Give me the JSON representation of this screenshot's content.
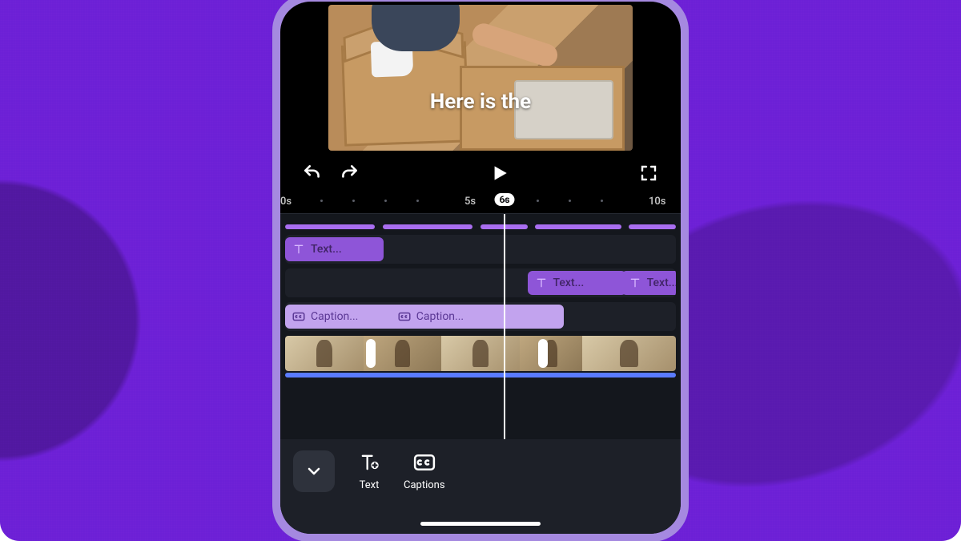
{
  "preview": {
    "caption_text": "Here is the"
  },
  "controls": {
    "undo_icon": "undo-icon",
    "redo_icon": "redo-icon",
    "play_icon": "play-icon",
    "fullscreen_icon": "fullscreen-icon"
  },
  "ruler": {
    "ticks": [
      "0s",
      "5s",
      "10s"
    ],
    "current_label": "6s",
    "playhead_pct": 56
  },
  "timeline": {
    "marker_segments_pct": [
      [
        0,
        23
      ],
      [
        25,
        48
      ],
      [
        50,
        62
      ],
      [
        64,
        86
      ],
      [
        88,
        100
      ]
    ],
    "text_clips_row1": [
      {
        "label": "Text...",
        "left_pct": 0,
        "width_pct": 22
      }
    ],
    "text_clips_row2": [
      {
        "label": "Text...",
        "left_pct": 62,
        "width_pct": 22
      },
      {
        "label": "Text...",
        "left_pct": 86,
        "width_pct": 22
      }
    ],
    "caption_clips": [
      {
        "label": "Caption...",
        "left_pct": 0,
        "width_pct": 26
      },
      {
        "label": "Caption...",
        "left_pct": 27,
        "width_pct": 41
      }
    ],
    "video_thumbs_pct": [
      [
        0,
        20
      ],
      [
        20,
        40
      ],
      [
        40,
        60
      ],
      [
        60,
        76
      ],
      [
        76,
        100
      ]
    ],
    "selection_handles_pct": [
      22,
      66
    ]
  },
  "bottombar": {
    "collapse_icon": "chevron-down-icon",
    "tools": [
      {
        "key": "text",
        "label": "Text"
      },
      {
        "key": "captions",
        "label": "Captions"
      }
    ]
  }
}
